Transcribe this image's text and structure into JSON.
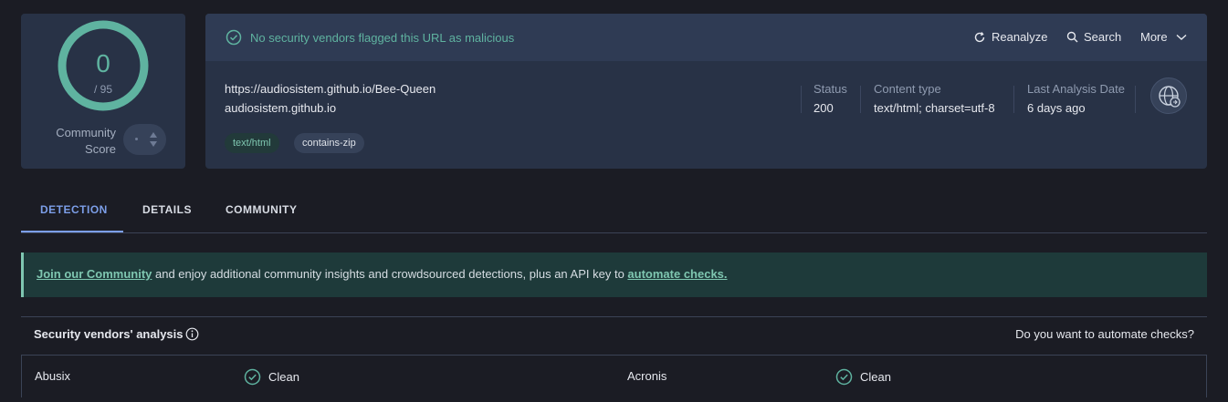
{
  "score": {
    "value": "0",
    "total": "/ 95",
    "community_label": "Community Score"
  },
  "banner": {
    "message": "No security vendors flagged this URL as malicious",
    "actions": {
      "reanalyze": "Reanalyze",
      "search": "Search",
      "more": "More"
    }
  },
  "url_info": {
    "url": "https://audiosistem.github.io/Bee-Queen",
    "domain": "audiosistem.github.io",
    "tags": [
      "text/html",
      "contains-zip"
    ]
  },
  "meta": {
    "status_label": "Status",
    "status_value": "200",
    "content_type_label": "Content type",
    "content_type_value": "text/html; charset=utf-8",
    "last_analysis_label": "Last Analysis Date",
    "last_analysis_value": "6 days ago"
  },
  "tabs": [
    "DETECTION",
    "DETAILS",
    "COMMUNITY"
  ],
  "community_banner": {
    "join_link": "Join our Community",
    "middle_text": " and enjoy additional community insights and crowdsourced detections, plus an API key to ",
    "automate_link": "automate checks."
  },
  "vendors": {
    "title": "Security vendors' analysis",
    "automate_question": "Do you want to automate checks?",
    "rows": [
      {
        "left_name": "Abusix",
        "left_result": "Clean",
        "right_name": "Acronis",
        "right_result": "Clean"
      }
    ]
  },
  "colors": {
    "clean": "#5fb3a0",
    "accent": "#7c9ee8",
    "background": "#1b1c24"
  }
}
